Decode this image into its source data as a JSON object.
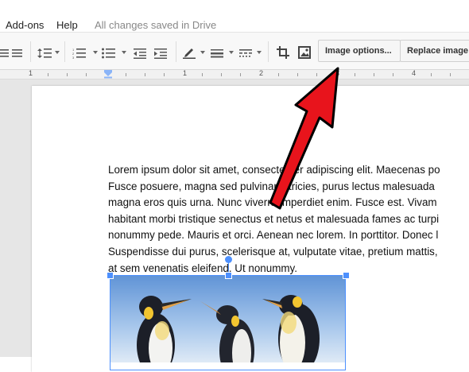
{
  "menu": {
    "items": [
      {
        "label": "Add-ons"
      },
      {
        "label": "Help"
      }
    ],
    "save_status": "All changes saved in Drive"
  },
  "toolbar": {
    "image_options_label": "Image options...",
    "replace_image_label": "Replace image"
  },
  "ruler": {
    "numbers": [
      "1",
      "1",
      "2",
      "3",
      "4"
    ]
  },
  "document": {
    "lines": [
      "Lorem ipsum dolor sit amet, consectetuer adipiscing elit. Maecenas po",
      "Fusce posuere, magna sed pulvinar ultricies, purus lectus malesuada",
      "magna eros quis urna. Nunc viverra imperdiet enim. Fusce est. Vivam",
      "habitant morbi tristique senectus et netus et malesuada fames ac turpi",
      "nonummy pede. Mauris et orci. Aenean nec lorem. In porttitor. Donec l",
      "Suspendisse dui purus, scelerisque at, vulputate vitae, pretium mattis,",
      "at sem venenatis eleifend. Ut nonummy."
    ]
  },
  "colors": {
    "arrow": "#e8141c",
    "selection": "#4d90fe"
  }
}
